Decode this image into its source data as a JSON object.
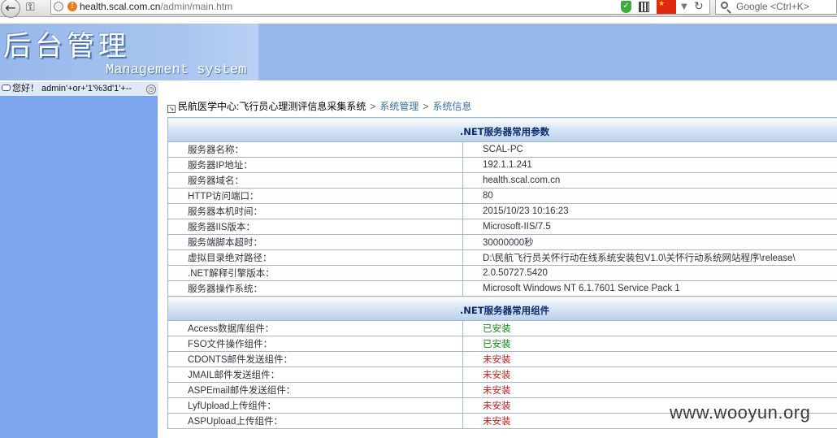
{
  "browser": {
    "url_host": "health.scal.com.cn",
    "url_path": "/admin/main.htm",
    "search_placeholder": "Google <Ctrl+K>"
  },
  "banner": {
    "title": "后台管理",
    "subtitle": "Management system"
  },
  "greeting": {
    "text": "您好！ admin'+or+'1'%3d'1'+--"
  },
  "breadcrumb": {
    "root": "民航医学中心:飞行员心理测评信息采集系统",
    "sep": ">",
    "section": "系统管理",
    "current": "系统信息"
  },
  "params_section": {
    "title": ".NET服务器常用参数",
    "rows": [
      {
        "label": "服务器名称：",
        "value": "SCAL-PC"
      },
      {
        "label": "服务器IP地址：",
        "value": "192.1.1.241"
      },
      {
        "label": "服务器域名：",
        "value": "health.scal.com.cn"
      },
      {
        "label": "HTTP访问端口：",
        "value": "80"
      },
      {
        "label": "服务器本机时间：",
        "value": "2015/10/23 10:16:23"
      },
      {
        "label": "服务器IIS版本：",
        "value": "Microsoft-IIS/7.5"
      },
      {
        "label": "服务端脚本超时：",
        "value": "30000000秒"
      },
      {
        "label": "虚拟目录绝对路径：",
        "value": "D:\\民航飞行员关怀行动在线系统安装包V1.0\\关怀行动系统网站程序\\release\\"
      },
      {
        "label": ".NET解释引擎版本：",
        "value": "2.0.50727.5420"
      },
      {
        "label": "服务器操作系统：",
        "value": "Microsoft Windows NT 6.1.7601 Service Pack 1"
      }
    ]
  },
  "components_section": {
    "title": ".NET服务器常用组件",
    "rows": [
      {
        "label": "Access数据库组件：",
        "value": "已安装",
        "status": "ok"
      },
      {
        "label": "FSO文件操作组件：",
        "value": "已安装",
        "status": "ok"
      },
      {
        "label": "CDONTS邮件发送组件：",
        "value": "未安装",
        "status": "no"
      },
      {
        "label": "JMAIL邮件发送组件：",
        "value": "未安装",
        "status": "no"
      },
      {
        "label": "ASPEmail邮件发送组件：",
        "value": "未安装",
        "status": "no"
      },
      {
        "label": "LyfUpload上传组件：",
        "value": "未安装",
        "status": "no"
      },
      {
        "label": "ASPUpload上传组件：",
        "value": "未安装",
        "status": "no"
      }
    ]
  },
  "watermark": "www.wooyun.org",
  "colors": {
    "installed": "#108a10",
    "not_installed": "#c81c1c",
    "sidebar": "#7ba5ec",
    "banner": "#97b8ea"
  }
}
